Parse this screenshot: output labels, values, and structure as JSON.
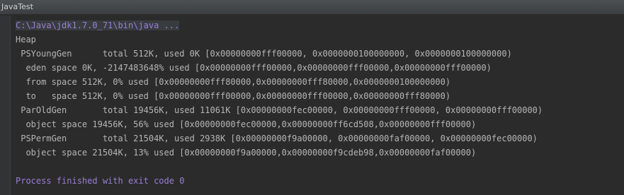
{
  "window": {
    "title": "JavaTest"
  },
  "colors": {
    "background": "#2b2b2b",
    "output_text": "#b5b5b5",
    "system_text": "#9a7ed6"
  },
  "console": {
    "command": "C:\\Java\\jdk1.7.0_71\\bin\\java ...",
    "output_lines": [
      "Heap",
      " PSYoungGen      total 512K, used 0K [0x00000000fff00000, 0x0000000100000000, 0x0000000100000000)",
      "  eden space 0K, -2147483648% used [0x00000000fff00000,0x00000000fff00000,0x00000000fff00000)",
      "  from space 512K, 0% used [0x00000000fff80000,0x00000000fff80000,0x0000000100000000)",
      "  to   space 512K, 0% used [0x00000000fff00000,0x00000000fff00000,0x00000000fff80000)",
      " ParOldGen       total 19456K, used 11061K [0x00000000fec00000, 0x00000000fff00000, 0x00000000fff00000)",
      "  object space 19456K, 56% used [0x00000000fec00000,0x00000000ff6cd508,0x00000000fff00000)",
      " PSPermGen       total 21504K, used 2938K [0x00000000f9a00000, 0x00000000faf00000, 0x00000000fec00000)",
      "  object space 21504K, 13% used [0x00000000f9a00000,0x00000000f9cdeb98,0x00000000faf00000)",
      ""
    ],
    "exit_message": "Process finished with exit code 0"
  }
}
